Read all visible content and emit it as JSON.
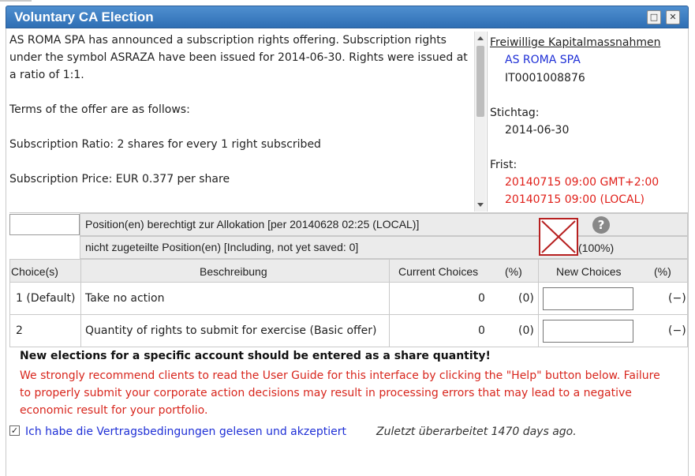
{
  "window": {
    "title": "Voluntary CA Election",
    "maximize_icon": "maximize-icon",
    "close_icon": "close-icon"
  },
  "description": {
    "p1": "AS ROMA SPA has announced a subscription rights offering. Subscription rights under the symbol ASRAZA have been issued for 2014-06-30. Rights were issued at a ratio of 1:1.",
    "p2": "Terms of the offer are as follows:",
    "p3": "Subscription Ratio: 2 shares for every 1 right subscribed",
    "p4": "Subscription Price: EUR 0.377 per share"
  },
  "side": {
    "header": "Freiwillige Kapitalmassnahmen",
    "company": "AS ROMA SPA",
    "isin": "IT0001008876",
    "record_label": "Stichtag:",
    "record_date": "2014-06-30",
    "deadline_label": "Frist:",
    "deadline_gmt": "20140715 09:00 GMT+2:00",
    "deadline_local": "20140715 09:00 (LOCAL)"
  },
  "positions": {
    "eligible": "Position(en) berechtigt zur Allokation [per   20140628 02:25 (LOCAL)]",
    "unallocated": "nicht zugeteilte Position(en) [Including, not yet saved: 0]",
    "percent": "(100%)"
  },
  "table": {
    "headers": {
      "choice": "Choice(s)",
      "description": "Beschreibung",
      "current": "Current Choices",
      "current_pct": "(%)",
      "new": "New Choices",
      "new_pct": "(%)"
    },
    "rows": [
      {
        "choice": "1 (Default)",
        "description": "Take no action",
        "current": "0",
        "current_pct": "(0)",
        "new_value": "",
        "new_pct": "(−)"
      },
      {
        "choice": "2",
        "description": "Quantity of rights to submit for exercise (Basic offer)",
        "current": "0",
        "current_pct": "(0)",
        "new_value": "",
        "new_pct": "(−)"
      }
    ]
  },
  "notice": {
    "bold": "New elections for a specific account should be entered as a share quantity!",
    "warning": "We strongly recommend clients to read the User Guide for this interface by clicking the \"Help\" button below. Failure to properly submit your corporate action decisions may result in processing errors that may lead to a negative economic result for your portfolio."
  },
  "accept": {
    "checked": true,
    "label": "Ich habe die Vertragsbedingungen gelesen und akzeptiert",
    "last_edited": "Zuletzt überarbeitet 1470 days ago."
  },
  "colors": {
    "titlebar": "#3a7cc4",
    "link_blue": "#1e2fd6",
    "warning_red": "#e0201a"
  }
}
